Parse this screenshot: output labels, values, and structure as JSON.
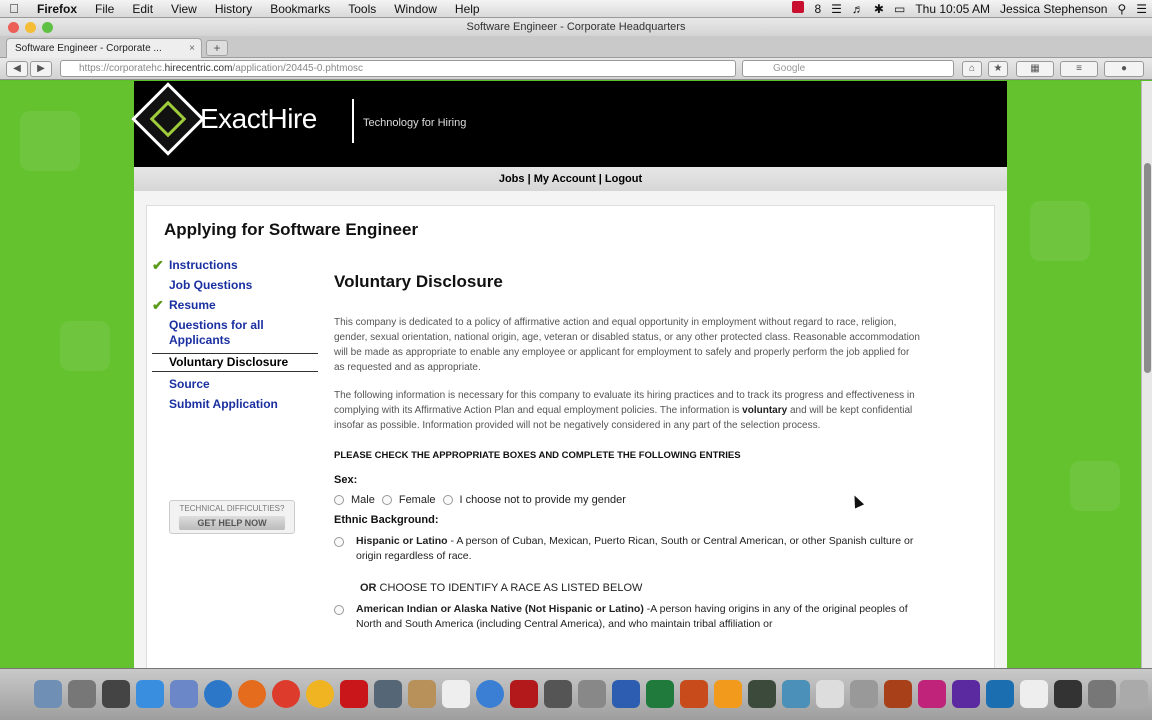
{
  "menubar": {
    "app": "Firefox",
    "items": [
      "File",
      "Edit",
      "View",
      "History",
      "Bookmarks",
      "Tools",
      "Window",
      "Help"
    ],
    "clock": "Thu 10:05 AM",
    "user": "Jessica Stephenson",
    "battery_count": "8"
  },
  "window": {
    "title": "Software Engineer - Corporate Headquarters"
  },
  "tab": {
    "title": "Software Engineer - Corporate ..."
  },
  "address": {
    "prefix": "https://corporatehc.",
    "domain": "hirecentric.com",
    "suffix": "/application/20445-0.phtmosc",
    "search_placeholder": "Google"
  },
  "site": {
    "logo": "ExactHire",
    "tagline": "Technology for Hiring",
    "nav": {
      "jobs": "Jobs",
      "account": "My Account",
      "logout": "Logout",
      "sep": "|"
    }
  },
  "application": {
    "title": "Applying for Software Engineer",
    "steps": [
      {
        "label": "Instructions",
        "done": true
      },
      {
        "label": "Job Questions",
        "done": false
      },
      {
        "label": "Resume",
        "done": true
      },
      {
        "label": "Questions for all Applicants",
        "done": false
      },
      {
        "label": "Voluntary Disclosure",
        "done": false,
        "active": true
      },
      {
        "label": "Source",
        "done": false
      },
      {
        "label": "Submit Application",
        "done": false
      }
    ],
    "help": {
      "caption": "TECHNICAL DIFFICULTIES?",
      "button": "GET HELP NOW"
    }
  },
  "disclosure": {
    "heading": "Voluntary Disclosure",
    "para1": "This company is dedicated to a policy of affirmative action and equal opportunity in employment without regard to race, religion, gender, sexual orientation, national origin, age, veteran or disabled status, or any other protected class. Reasonable accommodation will be made as appropriate to enable any employee or applicant for employment to safely and properly perform the job applied for as requested and as appropriate.",
    "para2_before": "The following information is necessary for this company to evaluate its hiring practices and to track its progress and effectiveness in complying with its Affirmative Action Plan and equal employment policies. The information is ",
    "para2_bold": "voluntary",
    "para2_after": " and will be kept confidential insofar as possible. Information provided will not be negatively considered in any part of the selection process.",
    "instruction": "PLEASE CHECK THE APPROPRIATE BOXES AND COMPLETE THE FOLLOWING ENTRIES",
    "sex_label": "Sex:",
    "sex_options": [
      "Male",
      "Female",
      "I choose not to provide my gender"
    ],
    "ethnic_label": "Ethnic Background:",
    "hispanic_bold": "Hispanic or Latino",
    "hispanic_desc": " - A person of Cuban, Mexican, Puerto Rican, South or Central American, or other Spanish culture or origin regardless of race.",
    "or_bold": "OR",
    "or_text": " CHOOSE TO IDENTIFY A RACE AS LISTED BELOW",
    "native_bold": "American Indian or Alaska Native (Not Hispanic or Latino)",
    "native_desc": " -A person having origins in any of the original peoples of North and South America (including Central America), and who maintain tribal affiliation or"
  },
  "colors": {
    "page_bg": "#63c22e",
    "link": "#1a2fa0",
    "check": "#5a9a1a",
    "header": "#000000"
  }
}
